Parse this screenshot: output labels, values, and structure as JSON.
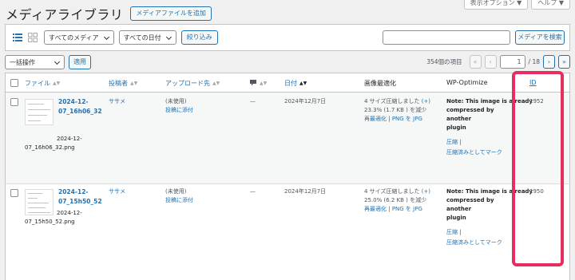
{
  "header": {
    "screen_options": "表示オプション ▼",
    "help": "ヘルプ ▼",
    "title": "メディアライブラリ",
    "add_media": "メディアファイルを追加"
  },
  "filters": {
    "media_type": "すべてのメディア",
    "date": "すべての日付",
    "filter_btn": "絞り込み",
    "search_btn": "メディアを検索",
    "search_placeholder": ""
  },
  "bulk": {
    "action": "一括操作",
    "apply": "適用"
  },
  "pagination": {
    "count": "354個の項目",
    "first": "«",
    "prev": "‹",
    "current": "1",
    "total": "/ 18",
    "next": "›",
    "last": "»"
  },
  "columns": {
    "file": "ファイル",
    "author": "投稿者",
    "uploaded_to": "アップロード先",
    "comments": "",
    "date": "日付",
    "image_opt": "画像最適化",
    "wp_optimize": "WP-Optimize",
    "id": "ID"
  },
  "rows": [
    {
      "title_line1": "2024-12-",
      "title_line2": "07_16h06_32",
      "filename_line1": "2024-12-",
      "filename_line2": "07_16h06_32.png",
      "author": "ササメ",
      "attach_status": "(未使用)",
      "attach_link": "投稿に添付",
      "comments": "—",
      "date": "2024年12月7日",
      "opt_line1": "4 サイズ圧縮しました",
      "opt_plus": "(+)",
      "opt_line2": "23.3% (1.7 KB ) を減少",
      "opt_reopt": "再最適化",
      "opt_sep": "|",
      "opt_jpg": "PNG を JPG",
      "wpo_line1": "Note: This image is already",
      "wpo_line2": "compressed by another",
      "wpo_line3": "plugin",
      "wpo_compress": "圧縮",
      "wpo_sep": "|",
      "wpo_mark": "圧縮済みとしてマーク",
      "id": "1952"
    },
    {
      "title_line1": "2024-12-",
      "title_line2": "07_15h50_52",
      "filename_line1": "2024-12-",
      "filename_line2": "07_15h50_52.png",
      "author": "ササメ",
      "attach_status": "(未使用)",
      "attach_link": "投稿に添付",
      "comments": "—",
      "date": "2024年12月7日",
      "opt_line1": "4 サイズ圧縮しました",
      "opt_plus": "(+)",
      "opt_line2": "25.0% (6.2 KB ) を減少",
      "opt_reopt": "再最適化",
      "opt_sep": "|",
      "opt_jpg": "PNG を JPG",
      "wpo_line1": "Note: This image is already",
      "wpo_line2": "compressed by another",
      "wpo_line3": "plugin",
      "wpo_compress": "圧縮",
      "wpo_sep": "|",
      "wpo_mark": "圧縮済みとしてマーク",
      "id": "1950"
    }
  ],
  "colors": {
    "accent": "#2271b1",
    "highlight": "#e62f5f"
  }
}
